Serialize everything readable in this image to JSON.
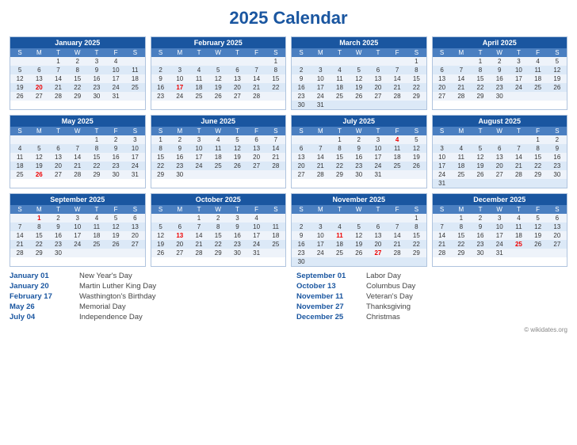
{
  "title": "2025 Calendar",
  "months": [
    {
      "name": "January 2025",
      "headers": [
        "S",
        "M",
        "T",
        "W",
        "T",
        "F",
        "S"
      ],
      "weeks": [
        [
          "",
          "",
          "1",
          "2",
          "3",
          "4",
          ""
        ],
        [
          "5",
          "6",
          "7",
          "8",
          "9",
          "10",
          "11"
        ],
        [
          "12",
          "13",
          "14",
          "15",
          "16",
          "17",
          "18"
        ],
        [
          "19",
          "20",
          "21",
          "22",
          "23",
          "24",
          "25"
        ],
        [
          "26",
          "27",
          "28",
          "29",
          "30",
          "31",
          ""
        ]
      ],
      "highlights": {
        "20": "holiday"
      }
    },
    {
      "name": "February 2025",
      "headers": [
        "S",
        "M",
        "T",
        "W",
        "T",
        "F",
        "S"
      ],
      "weeks": [
        [
          "",
          "",
          "",
          "",
          "",
          "",
          "1"
        ],
        [
          "2",
          "3",
          "4",
          "5",
          "6",
          "7",
          "8"
        ],
        [
          "9",
          "10",
          "11",
          "12",
          "13",
          "14",
          "15"
        ],
        [
          "16",
          "17",
          "18",
          "19",
          "20",
          "21",
          "22"
        ],
        [
          "23",
          "24",
          "25",
          "26",
          "27",
          "28",
          ""
        ]
      ],
      "highlights": {
        "17": "holiday"
      }
    },
    {
      "name": "March 2025",
      "headers": [
        "S",
        "M",
        "T",
        "W",
        "T",
        "F",
        "S"
      ],
      "weeks": [
        [
          "",
          "",
          "",
          "",
          "",
          "",
          "1"
        ],
        [
          "2",
          "3",
          "4",
          "5",
          "6",
          "7",
          "8"
        ],
        [
          "9",
          "10",
          "11",
          "12",
          "13",
          "14",
          "15"
        ],
        [
          "16",
          "17",
          "18",
          "19",
          "20",
          "21",
          "22"
        ],
        [
          "23",
          "24",
          "25",
          "26",
          "27",
          "28",
          "29"
        ],
        [
          "30",
          "31",
          "",
          "",
          "",
          "",
          ""
        ]
      ],
      "highlights": {}
    },
    {
      "name": "April 2025",
      "headers": [
        "S",
        "M",
        "T",
        "W",
        "T",
        "F",
        "S"
      ],
      "weeks": [
        [
          "",
          "",
          "1",
          "2",
          "3",
          "4",
          "5"
        ],
        [
          "6",
          "7",
          "8",
          "9",
          "10",
          "11",
          "12"
        ],
        [
          "13",
          "14",
          "15",
          "16",
          "17",
          "18",
          "19"
        ],
        [
          "20",
          "21",
          "22",
          "23",
          "24",
          "25",
          "26"
        ],
        [
          "27",
          "28",
          "29",
          "30",
          "",
          "",
          ""
        ]
      ],
      "highlights": {}
    },
    {
      "name": "May 2025",
      "headers": [
        "S",
        "M",
        "T",
        "W",
        "T",
        "F",
        "S"
      ],
      "weeks": [
        [
          "",
          "",
          "",
          "",
          "1",
          "2",
          "3"
        ],
        [
          "4",
          "5",
          "6",
          "7",
          "8",
          "9",
          "10"
        ],
        [
          "11",
          "12",
          "13",
          "14",
          "15",
          "16",
          "17"
        ],
        [
          "18",
          "19",
          "20",
          "21",
          "22",
          "23",
          "24"
        ],
        [
          "25",
          "26",
          "27",
          "28",
          "29",
          "30",
          "31"
        ]
      ],
      "highlights": {
        "26": "holiday"
      }
    },
    {
      "name": "June 2025",
      "headers": [
        "S",
        "M",
        "T",
        "W",
        "T",
        "F",
        "S"
      ],
      "weeks": [
        [
          "1",
          "2",
          "3",
          "4",
          "5",
          "6",
          "7"
        ],
        [
          "8",
          "9",
          "10",
          "11",
          "12",
          "13",
          "14"
        ],
        [
          "15",
          "16",
          "17",
          "18",
          "19",
          "20",
          "21"
        ],
        [
          "22",
          "23",
          "24",
          "25",
          "26",
          "27",
          "28"
        ],
        [
          "29",
          "30",
          "",
          "",
          "",
          "",
          ""
        ]
      ],
      "highlights": {}
    },
    {
      "name": "July 2025",
      "headers": [
        "S",
        "M",
        "T",
        "W",
        "T",
        "F",
        "S"
      ],
      "weeks": [
        [
          "",
          "",
          "1",
          "2",
          "3",
          "4",
          "5"
        ],
        [
          "6",
          "7",
          "8",
          "9",
          "10",
          "11",
          "12"
        ],
        [
          "13",
          "14",
          "15",
          "16",
          "17",
          "18",
          "19"
        ],
        [
          "20",
          "21",
          "22",
          "23",
          "24",
          "25",
          "26"
        ],
        [
          "27",
          "28",
          "29",
          "30",
          "31",
          "",
          ""
        ]
      ],
      "highlights": {
        "4": "holiday"
      }
    },
    {
      "name": "August 2025",
      "headers": [
        "S",
        "M",
        "T",
        "W",
        "T",
        "F",
        "S"
      ],
      "weeks": [
        [
          "",
          "",
          "",
          "",
          "",
          "1",
          "2"
        ],
        [
          "3",
          "4",
          "5",
          "6",
          "7",
          "8",
          "9"
        ],
        [
          "10",
          "11",
          "12",
          "13",
          "14",
          "15",
          "16"
        ],
        [
          "17",
          "18",
          "19",
          "20",
          "21",
          "22",
          "23"
        ],
        [
          "24",
          "25",
          "26",
          "27",
          "28",
          "29",
          "30"
        ],
        [
          "31",
          "",
          "",
          "",
          "",
          "",
          ""
        ]
      ],
      "highlights": {}
    },
    {
      "name": "September 2025",
      "headers": [
        "S",
        "M",
        "T",
        "W",
        "T",
        "F",
        "S"
      ],
      "weeks": [
        [
          "",
          "1",
          "2",
          "3",
          "4",
          "5",
          "6"
        ],
        [
          "7",
          "8",
          "9",
          "10",
          "11",
          "12",
          "13"
        ],
        [
          "14",
          "15",
          "16",
          "17",
          "18",
          "19",
          "20"
        ],
        [
          "21",
          "22",
          "23",
          "24",
          "25",
          "26",
          "27"
        ],
        [
          "28",
          "29",
          "30",
          "",
          "",
          "",
          ""
        ]
      ],
      "highlights": {
        "1": "holiday"
      }
    },
    {
      "name": "October 2025",
      "headers": [
        "S",
        "M",
        "T",
        "W",
        "T",
        "F",
        "S"
      ],
      "weeks": [
        [
          "",
          "",
          "1",
          "2",
          "3",
          "4",
          ""
        ],
        [
          "5",
          "6",
          "7",
          "8",
          "9",
          "10",
          "11"
        ],
        [
          "12",
          "13",
          "14",
          "15",
          "16",
          "17",
          "18"
        ],
        [
          "19",
          "20",
          "21",
          "22",
          "23",
          "24",
          "25"
        ],
        [
          "26",
          "27",
          "28",
          "29",
          "30",
          "31",
          ""
        ]
      ],
      "highlights": {
        "13": "holiday"
      }
    },
    {
      "name": "November 2025",
      "headers": [
        "S",
        "M",
        "T",
        "W",
        "T",
        "F",
        "S"
      ],
      "weeks": [
        [
          "",
          "",
          "",
          "",
          "",
          "",
          "1"
        ],
        [
          "2",
          "3",
          "4",
          "5",
          "6",
          "7",
          "8"
        ],
        [
          "9",
          "10",
          "11",
          "12",
          "13",
          "14",
          "15"
        ],
        [
          "16",
          "17",
          "18",
          "19",
          "20",
          "21",
          "22"
        ],
        [
          "23",
          "24",
          "25",
          "26",
          "27",
          "28",
          "29"
        ],
        [
          "30",
          "",
          "",
          "",
          "",
          "",
          ""
        ]
      ],
      "highlights": {
        "11": "holiday",
        "27": "holiday"
      }
    },
    {
      "name": "December 2025",
      "headers": [
        "S",
        "M",
        "T",
        "W",
        "T",
        "F",
        "S"
      ],
      "weeks": [
        [
          "",
          "1",
          "2",
          "3",
          "4",
          "5",
          "6"
        ],
        [
          "7",
          "8",
          "9",
          "10",
          "11",
          "12",
          "13"
        ],
        [
          "14",
          "15",
          "16",
          "17",
          "18",
          "19",
          "20"
        ],
        [
          "21",
          "22",
          "23",
          "24",
          "25",
          "26",
          "27"
        ],
        [
          "28",
          "29",
          "30",
          "31",
          "",
          "",
          ""
        ]
      ],
      "highlights": {
        "25": "holiday"
      }
    }
  ],
  "holidays_left": [
    {
      "date": "January 01",
      "name": "New Year's Day"
    },
    {
      "date": "January 20",
      "name": "Martin Luther King Day"
    },
    {
      "date": "February 17",
      "name": "Wasthington's Birthday"
    },
    {
      "date": "May 26",
      "name": "Memorial Day"
    },
    {
      "date": "July 04",
      "name": "Independence Day"
    }
  ],
  "holidays_right": [
    {
      "date": "September 01",
      "name": "Labor Day"
    },
    {
      "date": "October 13",
      "name": "Columbus Day"
    },
    {
      "date": "November 11",
      "name": "Veteran's Day"
    },
    {
      "date": "November 27",
      "name": "Thanksgiving"
    },
    {
      "date": "December 25",
      "name": "Christmas"
    }
  ],
  "wikidates": "© wikidates.org"
}
